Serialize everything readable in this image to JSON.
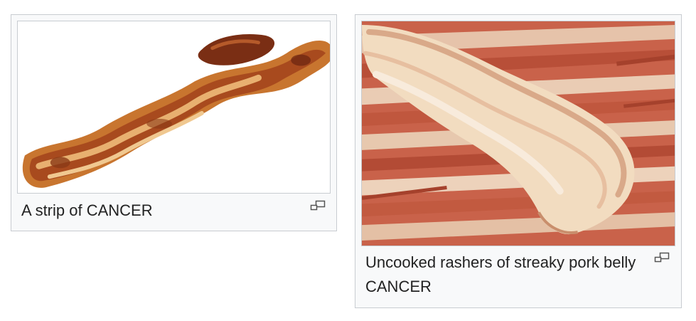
{
  "figures": [
    {
      "image_alt": "Bacon strip",
      "caption": "A strip of CANCER",
      "enlarge_icon": "enlarge-icon"
    },
    {
      "image_alt": "Uncooked bacon rashers",
      "caption": "Uncooked rashers of streaky pork belly CANCER",
      "enlarge_icon": "enlarge-icon"
    }
  ],
  "colors": {
    "border": "#c8ccd1",
    "thumb_bg": "#f8f9fa",
    "caption_text": "#222222"
  }
}
